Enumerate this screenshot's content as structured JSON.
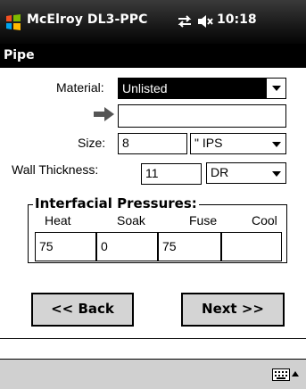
{
  "titlebar": {
    "app_title": "McElroy DL3-PPC",
    "time": "10:18"
  },
  "header": {
    "title": "Pipe"
  },
  "form": {
    "material": {
      "label": "Material:",
      "value": "Unlisted"
    },
    "custom_material": {
      "value": ""
    },
    "size": {
      "label": "Size:",
      "value": "8",
      "unit": "\" IPS"
    },
    "wall_thickness": {
      "label": "Wall Thickness:",
      "value": "11",
      "unit": "DR"
    },
    "pressures": {
      "title": "Interfacial Pressures:",
      "columns": [
        {
          "label": "Heat",
          "value": "75"
        },
        {
          "label": "Soak",
          "value": "0"
        },
        {
          "label": "Fuse",
          "value": "75"
        },
        {
          "label": "Cool",
          "value": ""
        }
      ]
    }
  },
  "buttons": {
    "back": "<< Back",
    "next": "Next >>"
  },
  "icons": {
    "logo": "windows-flag-icon",
    "sync": "sync-arrows-icon",
    "volume": "speaker-muted-icon",
    "arrow": "right-arrow-icon",
    "keyboard": "keyboard-icon"
  },
  "colors": {
    "titlebar": "#1b1b1b",
    "header": "#000000",
    "button": "#d4d4d4",
    "menubar": "#d0d0d0",
    "arrow": "#555555"
  }
}
